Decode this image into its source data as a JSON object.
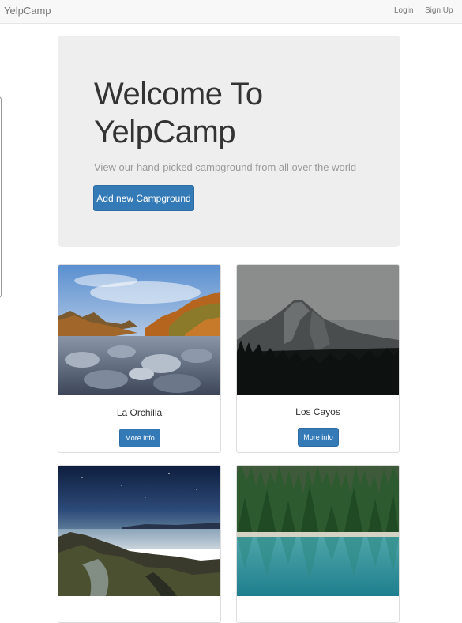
{
  "navbar": {
    "brand": "YelpCamp",
    "links": [
      {
        "label": "Login"
      },
      {
        "label": "Sign Up"
      }
    ]
  },
  "jumbotron": {
    "title_line1": "Welcome To",
    "title_line2": "YelpCamp",
    "subtitle": "View our hand-picked campground from all over the world",
    "add_button": "Add new Campground"
  },
  "campgrounds": [
    {
      "name": "La Orchilla",
      "button": "More info",
      "image": "rocky-river-autumn-forest"
    },
    {
      "name": "Los Cayos",
      "button": "More info",
      "image": "mountain-dusk-pine-forest"
    },
    {
      "name": "",
      "button": "",
      "image": "night-rocky-shore"
    },
    {
      "name": "",
      "button": "",
      "image": "pine-forest-lake-reflection"
    }
  ],
  "colors": {
    "primary": "#337ab7",
    "jumbotron_bg": "#eeeeee",
    "navbar_bg": "#f8f8f8"
  }
}
